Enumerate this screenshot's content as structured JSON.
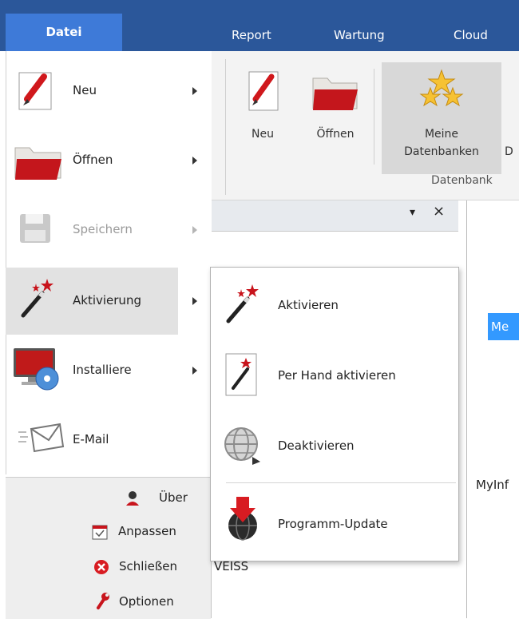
{
  "ribbon": {
    "file_tab": "Datei",
    "tabs": [
      "Report",
      "Wartung",
      "Cloud"
    ],
    "buttons": {
      "new": "Neu",
      "open": "Öffnen",
      "my_db_line1": "Meine",
      "my_db_line2": "Datenbanken",
      "partial_d": "D"
    },
    "group_label": "Datenbank"
  },
  "pane": {
    "dropdown": "▾",
    "close": "×"
  },
  "document": {
    "highlight_text": "Me",
    "text_myinfo": "MyInf",
    "text_weiss": "VEISS"
  },
  "menu": {
    "items": [
      {
        "label": "Neu"
      },
      {
        "label": "Öffnen"
      },
      {
        "label": "Speichern"
      },
      {
        "label": "Aktivierung"
      },
      {
        "label": "Installiere"
      },
      {
        "label": "E-Mail"
      }
    ],
    "bottom": [
      {
        "label": "Über"
      },
      {
        "label": "Anpassen"
      },
      {
        "label": "Schließen"
      },
      {
        "label": "Optionen"
      }
    ]
  },
  "submenu": {
    "items": [
      {
        "label": "Aktivieren"
      },
      {
        "label": "Per Hand aktivieren"
      },
      {
        "label": "Deaktivieren"
      },
      {
        "label": "Programm-Update"
      }
    ]
  },
  "colors": {
    "ribbon": "#2b579a",
    "file_tab": "#3e7ad8",
    "highlight": "#3399ff",
    "active_item": "#e2e2e2"
  }
}
